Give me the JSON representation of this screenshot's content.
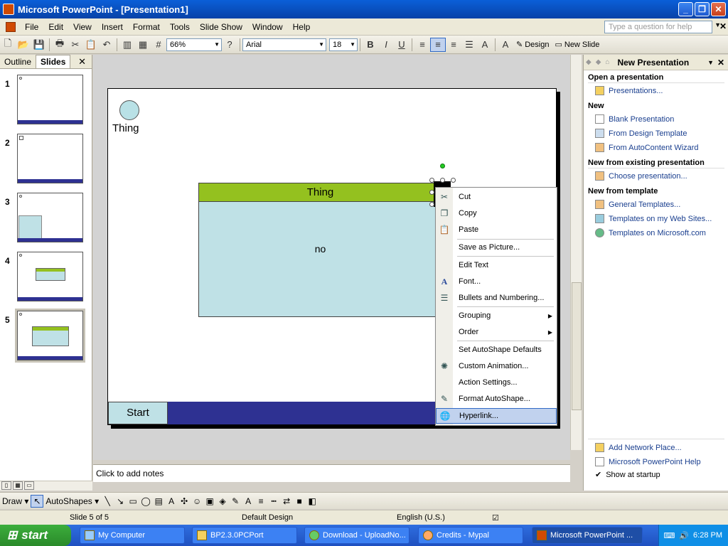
{
  "window": {
    "title": "Microsoft PowerPoint - [Presentation1]",
    "buttons": {
      "minimize": "_",
      "restore": "❐",
      "close": "✕"
    }
  },
  "menubar": {
    "items": [
      "File",
      "Edit",
      "View",
      "Insert",
      "Format",
      "Tools",
      "Slide Show",
      "Window",
      "Help"
    ],
    "help_placeholder": "Type a question for help"
  },
  "toolbar": {
    "zoom": "66%",
    "font": "Arial",
    "font_size": "18",
    "bold": "B",
    "italic": "I",
    "underline": "U",
    "design_label": "Design",
    "new_slide_label": "New Slide"
  },
  "slides_pane": {
    "tabs": [
      "Outline",
      "Slides"
    ],
    "active_tab": "Slides",
    "close": "✕",
    "thumbnails": [
      "1",
      "2",
      "3",
      "4",
      "5"
    ],
    "selected": 5
  },
  "slide": {
    "circle_label": "Thing",
    "box_title": "Thing",
    "box_body": "no",
    "start_button": "Start",
    "colors": {
      "header": "#94c11f",
      "box": "#bfe1e6",
      "footer": "#2e3192"
    }
  },
  "context_menu": {
    "items": [
      {
        "label": "Cut",
        "icon": "scissors-icon"
      },
      {
        "label": "Copy",
        "icon": "copy-icon"
      },
      {
        "label": "Paste",
        "icon": "paste-icon"
      },
      {
        "label": "Save as Picture...",
        "icon": ""
      },
      {
        "label": "Edit Text",
        "icon": ""
      },
      {
        "label": "Font...",
        "icon": "font-icon"
      },
      {
        "label": "Bullets and Numbering...",
        "icon": "bullets-icon"
      },
      {
        "label": "Grouping",
        "icon": "",
        "submenu": true
      },
      {
        "label": "Order",
        "icon": "",
        "submenu": true
      },
      {
        "label": "Set AutoShape Defaults",
        "icon": ""
      },
      {
        "label": "Custom Animation...",
        "icon": "animation-icon"
      },
      {
        "label": "Action Settings...",
        "icon": ""
      },
      {
        "label": "Format AutoShape...",
        "icon": "format-autoshape-icon"
      },
      {
        "label": "Hyperlink...",
        "icon": "hyperlink-icon",
        "highlighted": true
      }
    ]
  },
  "task_pane": {
    "title": "New Presentation",
    "sections": {
      "open": "Open a presentation",
      "new": "New",
      "existing": "New from existing presentation",
      "template": "New from template"
    },
    "links": {
      "presentations": "Presentations...",
      "blank": "Blank Presentation",
      "design_template": "From Design Template",
      "autocontent": "From AutoContent Wizard",
      "choose": "Choose presentation...",
      "general": "General Templates...",
      "web_sites": "Templates on my Web Sites...",
      "microsoft": "Templates on Microsoft.com",
      "network_place": "Add Network Place...",
      "help": "Microsoft PowerPoint Help",
      "show_startup": "Show at startup"
    }
  },
  "notes": {
    "placeholder": "Click to add notes"
  },
  "drawbar": {
    "draw": "Draw",
    "autoshapes": "AutoShapes"
  },
  "statusbar": {
    "slide": "Slide 5 of 5",
    "design": "Default Design",
    "language": "English (U.S.)"
  },
  "taskbar": {
    "start": "start",
    "tasks": [
      "My Computer",
      "BP2.3.0PCPort",
      "Download - UploadNo...",
      "Credits - Mypal",
      "Microsoft PowerPoint ..."
    ],
    "time": "6:28 PM"
  }
}
